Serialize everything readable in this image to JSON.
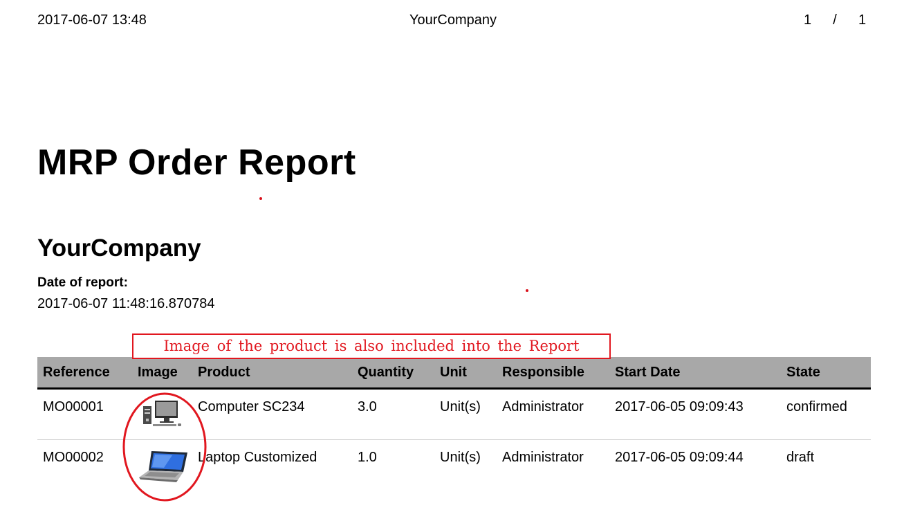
{
  "header": {
    "datetime": "2017-06-07 13:48",
    "company": "YourCompany",
    "page_current": "1",
    "page_separator": "/",
    "page_total": "1"
  },
  "report": {
    "title": "MRP Order Report",
    "company": "YourCompany",
    "date_label": "Date of report:",
    "date_value": "2017-06-07 11:48:16.870784"
  },
  "annotation": {
    "text": "Image of the product is also included into the Report",
    "color": "#e1171f"
  },
  "table": {
    "columns": [
      "Reference",
      "Image",
      "Product",
      "Quantity",
      "Unit",
      "Responsible",
      "Start Date",
      "State"
    ],
    "rows": [
      {
        "reference": "MO00001",
        "image_icon": "desktop-computer-icon",
        "product": "Computer SC234",
        "quantity": "3.0",
        "unit": "Unit(s)",
        "responsible": "Administrator",
        "start_date": "2017-06-05 09:09:43",
        "state": "confirmed"
      },
      {
        "reference": "MO00002",
        "image_icon": "laptop-icon",
        "product": "Laptop Customized",
        "quantity": "1.0",
        "unit": "Unit(s)",
        "responsible": "Administrator",
        "start_date": "2017-06-05 09:09:44",
        "state": "draft"
      }
    ],
    "header_bg": "#a8a8a8"
  }
}
